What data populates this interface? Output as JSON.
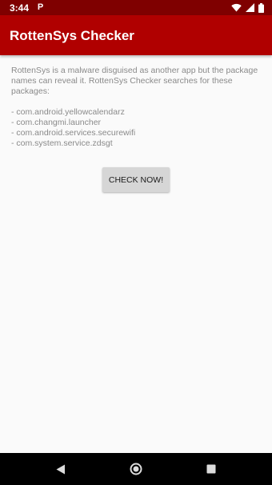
{
  "status_bar": {
    "time": "3:44",
    "notification_glyph": "P",
    "icons": [
      "wifi-icon",
      "signal-icon",
      "battery-icon"
    ],
    "background": "#7f0000"
  },
  "app_bar": {
    "title": "RottenSys Checker",
    "background": "#b00000"
  },
  "main": {
    "description": "RottenSys is a malware disguised as another app but the package names can reveal it. RottenSys Checker searches for these packages:",
    "packages": [
      "- com.android.yellowcalendarz",
      "- com.changmi.launcher",
      "- com.android.services.securewifi",
      "- com.system.service.zdsgt"
    ],
    "check_button_label": "CHECK NOW!"
  },
  "nav_bar": {
    "icons": [
      "back-icon",
      "home-icon",
      "recents-icon"
    ],
    "background": "#000000"
  }
}
